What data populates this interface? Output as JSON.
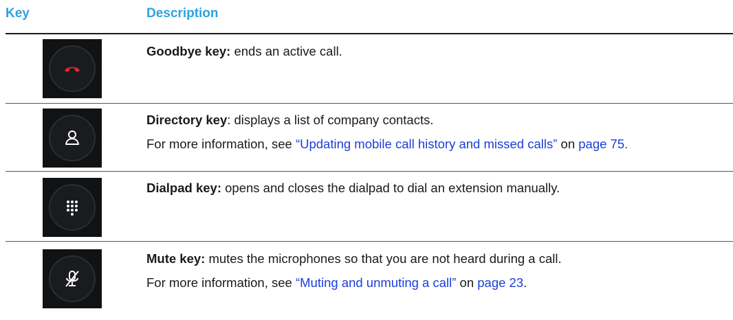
{
  "header": {
    "key": "Key",
    "description": "Description"
  },
  "rows": [
    {
      "icon": "end-call-icon",
      "title": "Goodbye key:",
      "text": " ends an active call."
    },
    {
      "icon": "person-icon",
      "title": "Directory key",
      "text": ": displays a list of company contacts.",
      "more_prefix": "For more information, see ",
      "link_text": "“Updating mobile call history and missed calls”",
      "mid": " on ",
      "page_link": "page 75",
      "suffix": "."
    },
    {
      "icon": "dialpad-icon",
      "title": "Dialpad key:",
      "text": " opens and closes the dialpad to dial an extension manually."
    },
    {
      "icon": "mic-muted-icon",
      "title": "Mute key:",
      "text": " mutes the microphones so that you are not heard during a call.",
      "more_prefix": "For more information, see ",
      "link_text": "“Muting and unmuting a call”",
      "mid": " on ",
      "page_link": "page 23",
      "suffix": "."
    }
  ],
  "colors": {
    "accent": "#2ea3e0",
    "link": "#1a3fd8",
    "end_call": "#e02a2a",
    "icon_bg": "#111214"
  }
}
